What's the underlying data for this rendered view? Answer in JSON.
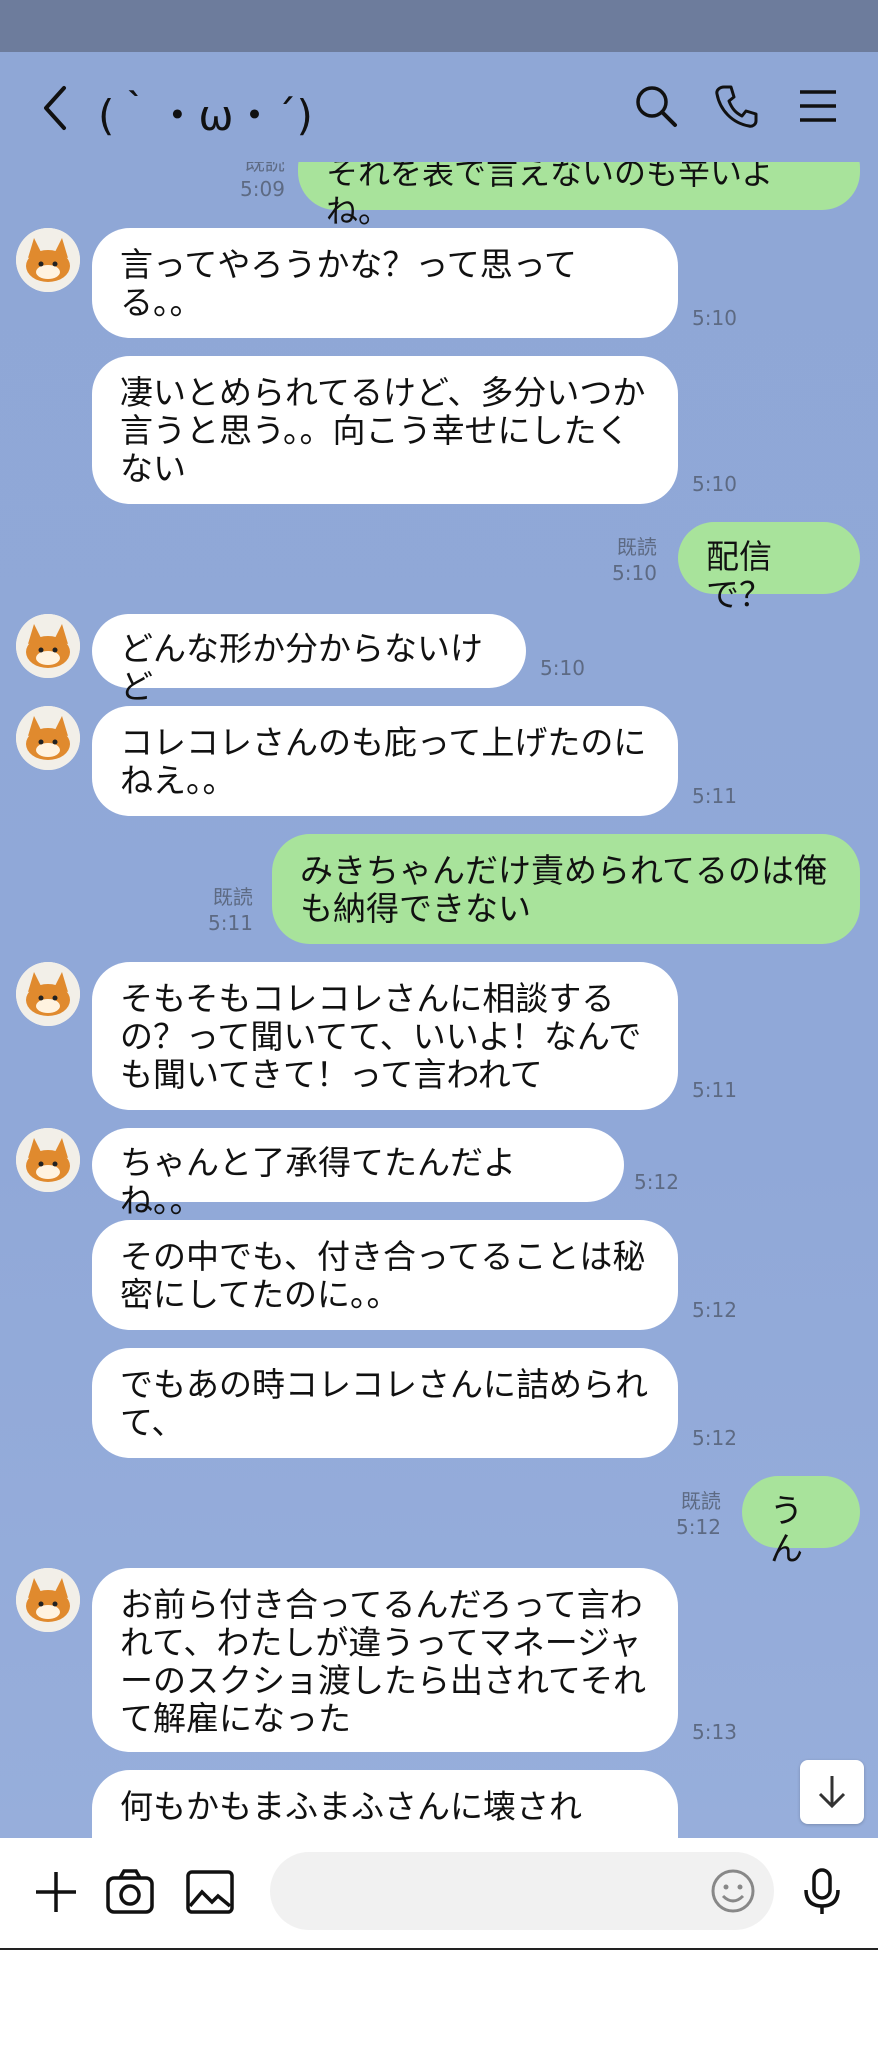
{
  "header": {
    "title": "(｀・ω・´)"
  },
  "colors": {
    "chat_background": "#90a8d8",
    "my_bubble": "#a8e39b",
    "their_bubble": "#ffffff",
    "status_bar": "#6d7c9c"
  },
  "icons": [
    "back-icon",
    "search-icon",
    "phone-icon",
    "menu-icon",
    "plus-icon",
    "camera-icon",
    "image-icon",
    "emoji-icon",
    "mic-icon",
    "arrow-down-icon"
  ],
  "messages": [
    {
      "side": "me",
      "text": "それを表で言えないのも辛いよね。",
      "read": "既読",
      "time": "5:09"
    },
    {
      "side": "them",
      "text": "言ってやろうかな？って思ってる。。",
      "time": "5:10"
    },
    {
      "side": "them",
      "text": "凄いとめられてるけど、多分いつか言うと思う。。向こう幸せにしたくない",
      "time": "5:10"
    },
    {
      "side": "me",
      "text": "配信で？",
      "read": "既読",
      "time": "5:10"
    },
    {
      "side": "them",
      "text": "どんな形か分からないけど",
      "time": "5:10"
    },
    {
      "side": "them",
      "text": "コレコレさんのも庇って上げたのにねえ。。",
      "time": "5:11"
    },
    {
      "side": "me",
      "text": "みきちゃんだけ責められてるのは俺も納得できない",
      "read": "既読",
      "time": "5:11"
    },
    {
      "side": "them",
      "text": "そもそもコレコレさんに相談するの？って聞いてて、いいよ！なんでも聞いてきて！って言われて",
      "time": "5:11"
    },
    {
      "side": "them",
      "text": "ちゃんと了承得てたんだよね。。",
      "time": "5:12"
    },
    {
      "side": "them",
      "text": "その中でも、付き合ってることは秘密にしてたのに。。",
      "time": "5:12"
    },
    {
      "side": "them",
      "text": "でもあの時コレコレさんに詰められて、",
      "time": "5:12"
    },
    {
      "side": "me",
      "text": "うん",
      "read": "既読",
      "time": "5:12"
    },
    {
      "side": "them",
      "text": "お前ら付き合ってるんだろって言われて、わたしが違うってマネージャーのスクショ渡したら出されてそれて解雇になった",
      "time": "5:13"
    },
    {
      "side": "them",
      "text": "何もかもまふまふさんに壊され",
      "time": ""
    }
  ]
}
